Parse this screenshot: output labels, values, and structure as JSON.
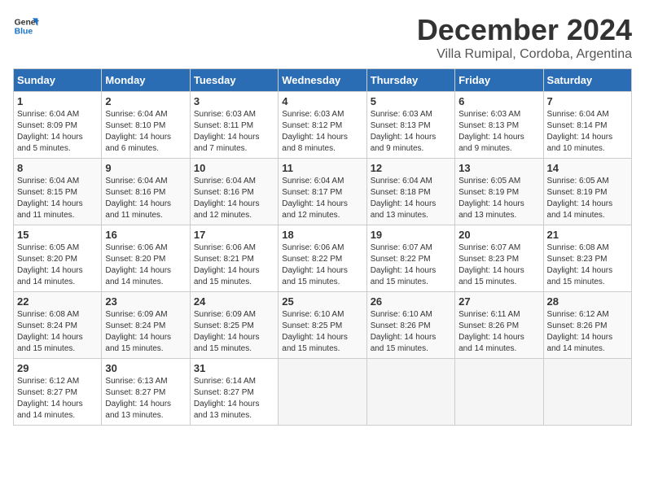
{
  "logo": {
    "line1": "General",
    "line2": "Blue"
  },
  "title": "December 2024",
  "location": "Villa Rumipal, Cordoba, Argentina",
  "days_of_week": [
    "Sunday",
    "Monday",
    "Tuesday",
    "Wednesday",
    "Thursday",
    "Friday",
    "Saturday"
  ],
  "weeks": [
    [
      {
        "day": "1",
        "sunrise": "6:04 AM",
        "sunset": "8:09 PM",
        "daylight": "14 hours and 5 minutes."
      },
      {
        "day": "2",
        "sunrise": "6:04 AM",
        "sunset": "8:10 PM",
        "daylight": "14 hours and 6 minutes."
      },
      {
        "day": "3",
        "sunrise": "6:03 AM",
        "sunset": "8:11 PM",
        "daylight": "14 hours and 7 minutes."
      },
      {
        "day": "4",
        "sunrise": "6:03 AM",
        "sunset": "8:12 PM",
        "daylight": "14 hours and 8 minutes."
      },
      {
        "day": "5",
        "sunrise": "6:03 AM",
        "sunset": "8:13 PM",
        "daylight": "14 hours and 9 minutes."
      },
      {
        "day": "6",
        "sunrise": "6:03 AM",
        "sunset": "8:13 PM",
        "daylight": "14 hours and 9 minutes."
      },
      {
        "day": "7",
        "sunrise": "6:04 AM",
        "sunset": "8:14 PM",
        "daylight": "14 hours and 10 minutes."
      }
    ],
    [
      {
        "day": "8",
        "sunrise": "6:04 AM",
        "sunset": "8:15 PM",
        "daylight": "14 hours and 11 minutes."
      },
      {
        "day": "9",
        "sunrise": "6:04 AM",
        "sunset": "8:16 PM",
        "daylight": "14 hours and 11 minutes."
      },
      {
        "day": "10",
        "sunrise": "6:04 AM",
        "sunset": "8:16 PM",
        "daylight": "14 hours and 12 minutes."
      },
      {
        "day": "11",
        "sunrise": "6:04 AM",
        "sunset": "8:17 PM",
        "daylight": "14 hours and 12 minutes."
      },
      {
        "day": "12",
        "sunrise": "6:04 AM",
        "sunset": "8:18 PM",
        "daylight": "14 hours and 13 minutes."
      },
      {
        "day": "13",
        "sunrise": "6:05 AM",
        "sunset": "8:19 PM",
        "daylight": "14 hours and 13 minutes."
      },
      {
        "day": "14",
        "sunrise": "6:05 AM",
        "sunset": "8:19 PM",
        "daylight": "14 hours and 14 minutes."
      }
    ],
    [
      {
        "day": "15",
        "sunrise": "6:05 AM",
        "sunset": "8:20 PM",
        "daylight": "14 hours and 14 minutes."
      },
      {
        "day": "16",
        "sunrise": "6:06 AM",
        "sunset": "8:20 PM",
        "daylight": "14 hours and 14 minutes."
      },
      {
        "day": "17",
        "sunrise": "6:06 AM",
        "sunset": "8:21 PM",
        "daylight": "14 hours and 15 minutes."
      },
      {
        "day": "18",
        "sunrise": "6:06 AM",
        "sunset": "8:22 PM",
        "daylight": "14 hours and 15 minutes."
      },
      {
        "day": "19",
        "sunrise": "6:07 AM",
        "sunset": "8:22 PM",
        "daylight": "14 hours and 15 minutes."
      },
      {
        "day": "20",
        "sunrise": "6:07 AM",
        "sunset": "8:23 PM",
        "daylight": "14 hours and 15 minutes."
      },
      {
        "day": "21",
        "sunrise": "6:08 AM",
        "sunset": "8:23 PM",
        "daylight": "14 hours and 15 minutes."
      }
    ],
    [
      {
        "day": "22",
        "sunrise": "6:08 AM",
        "sunset": "8:24 PM",
        "daylight": "14 hours and 15 minutes."
      },
      {
        "day": "23",
        "sunrise": "6:09 AM",
        "sunset": "8:24 PM",
        "daylight": "14 hours and 15 minutes."
      },
      {
        "day": "24",
        "sunrise": "6:09 AM",
        "sunset": "8:25 PM",
        "daylight": "14 hours and 15 minutes."
      },
      {
        "day": "25",
        "sunrise": "6:10 AM",
        "sunset": "8:25 PM",
        "daylight": "14 hours and 15 minutes."
      },
      {
        "day": "26",
        "sunrise": "6:10 AM",
        "sunset": "8:26 PM",
        "daylight": "14 hours and 15 minutes."
      },
      {
        "day": "27",
        "sunrise": "6:11 AM",
        "sunset": "8:26 PM",
        "daylight": "14 hours and 14 minutes."
      },
      {
        "day": "28",
        "sunrise": "6:12 AM",
        "sunset": "8:26 PM",
        "daylight": "14 hours and 14 minutes."
      }
    ],
    [
      {
        "day": "29",
        "sunrise": "6:12 AM",
        "sunset": "8:27 PM",
        "daylight": "14 hours and 14 minutes."
      },
      {
        "day": "30",
        "sunrise": "6:13 AM",
        "sunset": "8:27 PM",
        "daylight": "14 hours and 13 minutes."
      },
      {
        "day": "31",
        "sunrise": "6:14 AM",
        "sunset": "8:27 PM",
        "daylight": "14 hours and 13 minutes."
      },
      null,
      null,
      null,
      null
    ]
  ]
}
